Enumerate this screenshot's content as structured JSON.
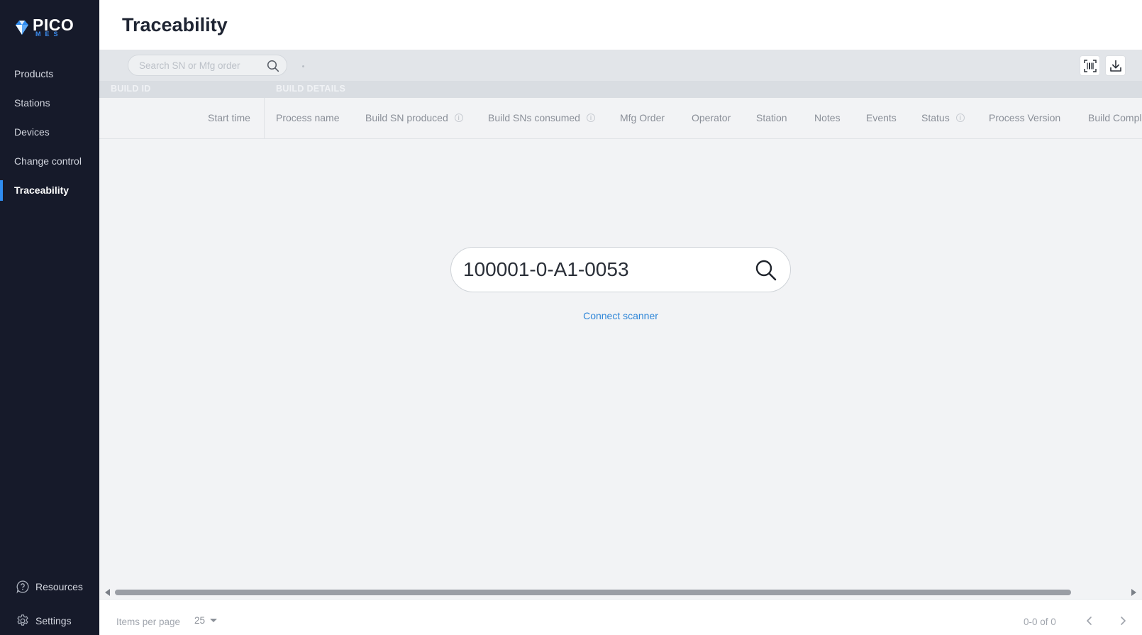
{
  "brand": {
    "name": "PICO",
    "sub": "MES",
    "accent": "#2f8cf0"
  },
  "sidebar": {
    "items": [
      {
        "label": "Products",
        "active": false
      },
      {
        "label": "Stations",
        "active": false
      },
      {
        "label": "Devices",
        "active": false
      },
      {
        "label": "Change control",
        "active": false
      },
      {
        "label": "Traceability",
        "active": true
      }
    ],
    "bottom": [
      {
        "label": "Resources",
        "icon": "help-circle-icon"
      },
      {
        "label": "Settings",
        "icon": "gear-icon"
      }
    ]
  },
  "header": {
    "title": "Traceability"
  },
  "toolbar": {
    "search_placeholder": "Search SN or Mfg order",
    "scan_icon": "barcode-scan-icon",
    "download_icon": "download-icon"
  },
  "table": {
    "groups": {
      "build_id": "BUILD ID",
      "build_details": "BUILD DETAILS"
    },
    "columns": [
      "Start time",
      "Process name",
      "Build SN produced",
      "Build SNs consumed",
      "Mfg Order",
      "Operator",
      "Station",
      "Notes",
      "Events",
      "Status",
      "Process Version",
      "Build Completed"
    ],
    "info_glyph": "i"
  },
  "center_search": {
    "value": "100001-0-A1-0053",
    "link": "Connect scanner"
  },
  "footer": {
    "items_per_page_label": "Items per page",
    "items_per_page_value": "25",
    "range": "0-0 of 0"
  }
}
